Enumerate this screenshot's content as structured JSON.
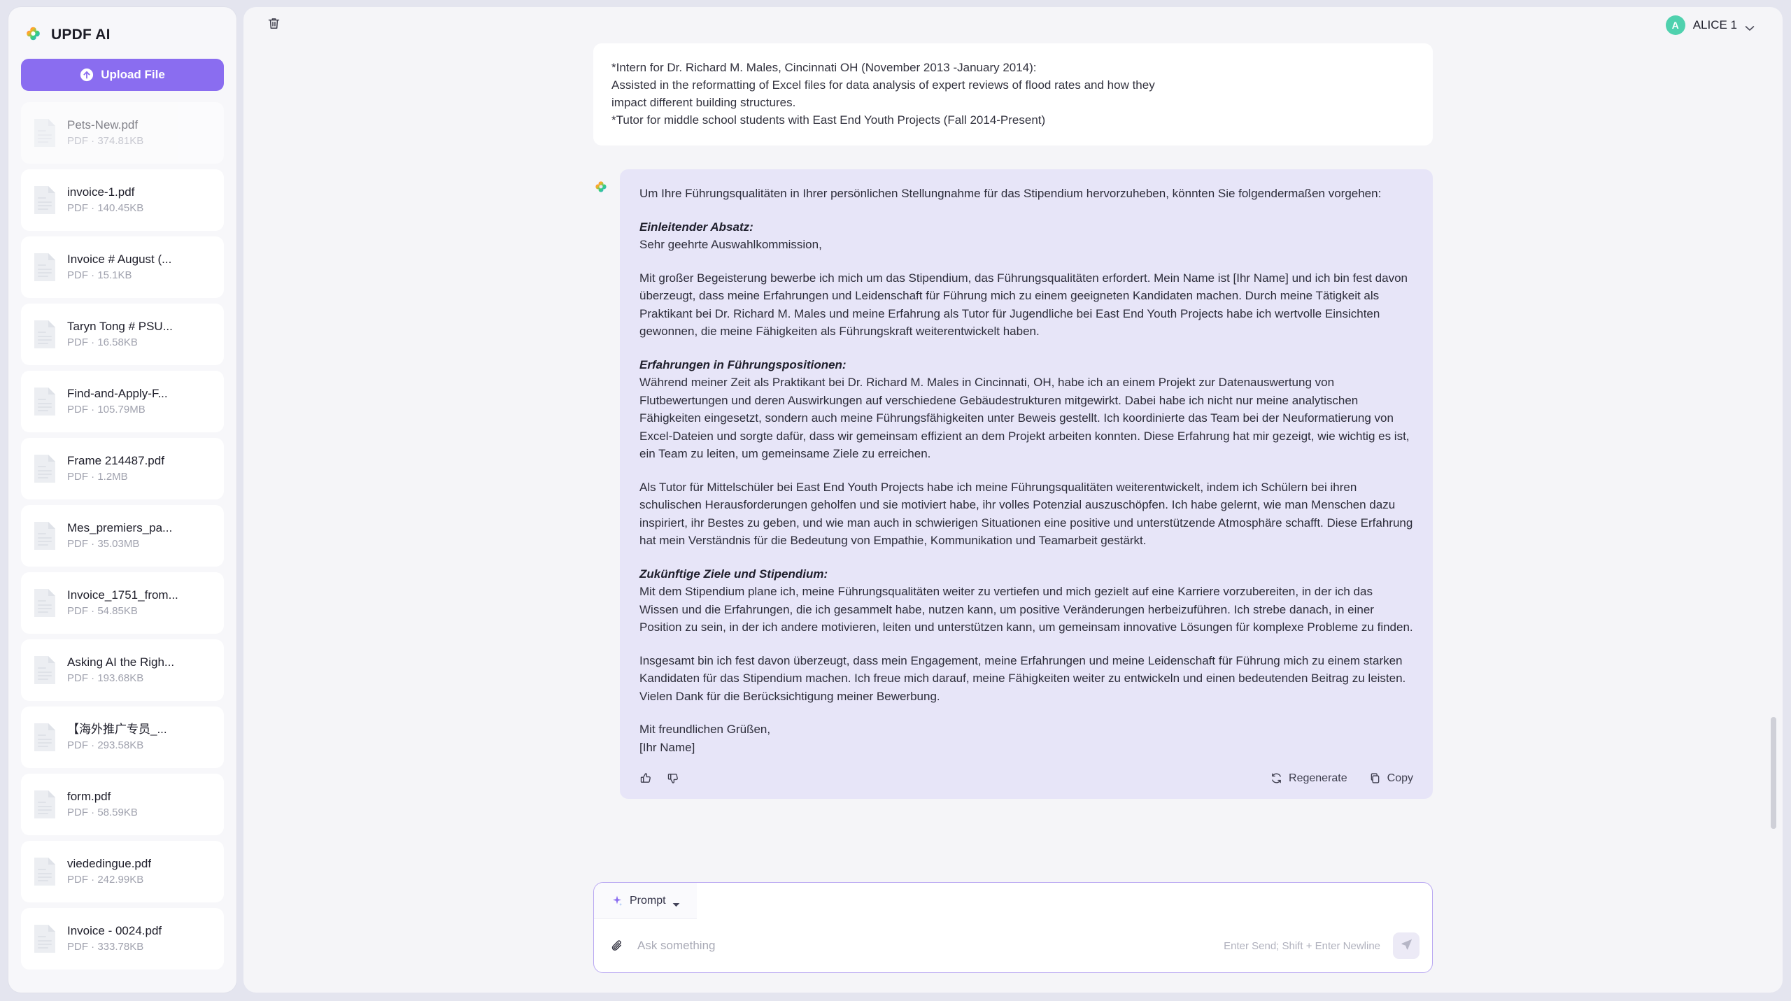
{
  "sidebar": {
    "brand": {
      "name": "UPDF AI",
      "logo_icon": "updf-flower-logo-icon"
    },
    "upload_button": {
      "label": "Upload File",
      "icon": "upload-arrow-icon"
    },
    "files": [
      {
        "name": "Pets-New.pdf",
        "meta": "PDF · 374.81KB"
      },
      {
        "name": "invoice-1.pdf",
        "meta": "PDF · 140.45KB"
      },
      {
        "name": "Invoice # August (...",
        "meta": "PDF · 15.1KB"
      },
      {
        "name": "Taryn Tong # PSU...",
        "meta": "PDF · 16.58KB"
      },
      {
        "name": "Find-and-Apply-F...",
        "meta": "PDF · 105.79MB"
      },
      {
        "name": "Frame 214487.pdf",
        "meta": "PDF · 1.2MB"
      },
      {
        "name": "Mes_premiers_pa...",
        "meta": "PDF · 35.03MB"
      },
      {
        "name": "Invoice_1751_from...",
        "meta": "PDF · 54.85KB"
      },
      {
        "name": "Asking AI the Righ...",
        "meta": "PDF · 193.68KB"
      },
      {
        "name": "【海外推广专员_...",
        "meta": "PDF · 293.58KB"
      },
      {
        "name": "form.pdf",
        "meta": "PDF · 58.59KB"
      },
      {
        "name": "viededingue.pdf",
        "meta": "PDF · 242.99KB"
      },
      {
        "name": "Invoice - 0024.pdf",
        "meta": "PDF · 333.78KB"
      }
    ]
  },
  "topbar": {
    "delete_icon": "trash-icon",
    "user": {
      "initial": "A",
      "name": "ALICE 1",
      "caret_icon": "chevron-down-icon"
    }
  },
  "conversation": {
    "user_message": "*Intern for Dr. Richard M. Males, Cincinnati OH (November 2013 -January 2014):\nAssisted in the reformatting of Excel files for data analysis of expert reviews of flood rates and how they\nimpact different building structures.\n*Tutor for middle school students with East End Youth Projects (Fall 2014-Present)",
    "ai_avatar_icon": "updf-ai-logo-icon",
    "ai_message": {
      "intro": "Um Ihre Führungsqualitäten in Ihrer persönlichen Stellungnahme für das Stipendium hervorzuheben, könnten Sie folgendermaßen vorgehen:",
      "sections": [
        {
          "heading": "Einleitender Absatz:",
          "paragraphs": [
            "Sehr geehrte Auswahlkommission,",
            "Mit großer Begeisterung bewerbe ich mich um das Stipendium, das Führungsqualitäten erfordert. Mein Name ist [Ihr Name] und ich bin fest davon überzeugt, dass meine Erfahrungen und Leidenschaft für Führung mich zu einem geeigneten Kandidaten machen. Durch meine Tätigkeit als Praktikant bei Dr. Richard M. Males und meine Erfahrung als Tutor für Jugendliche bei East End Youth Projects habe ich wertvolle Einsichten gewonnen, die meine Fähigkeiten als Führungskraft weiterentwickelt haben."
          ]
        },
        {
          "heading": "Erfahrungen in Führungspositionen:",
          "paragraphs": [
            "Während meiner Zeit als Praktikant bei Dr. Richard M. Males in Cincinnati, OH, habe ich an einem Projekt zur Datenauswertung von Flutbewertungen und deren Auswirkungen auf verschiedene Gebäudestrukturen mitgewirkt. Dabei habe ich nicht nur meine analytischen Fähigkeiten eingesetzt, sondern auch meine Führungsfähigkeiten unter Beweis gestellt. Ich koordinierte das Team bei der Neuformatierung von Excel-Dateien und sorgte dafür, dass wir gemeinsam effizient an dem Projekt arbeiten konnten. Diese Erfahrung hat mir gezeigt, wie wichtig es ist, ein Team zu leiten, um gemeinsame Ziele zu erreichen.",
            "Als Tutor für Mittelschüler bei East End Youth Projects habe ich meine Führungsqualitäten weiterentwickelt, indem ich Schülern bei ihren schulischen Herausforderungen geholfen und sie motiviert habe, ihr volles Potenzial auszuschöpfen. Ich habe gelernt, wie man Menschen dazu inspiriert, ihr Bestes zu geben, und wie man auch in schwierigen Situationen eine positive und unterstützende Atmosphäre schafft. Diese Erfahrung hat mein Verständnis für die Bedeutung von Empathie, Kommunikation und Teamarbeit gestärkt."
          ]
        },
        {
          "heading": "Zukünftige Ziele und Stipendium:",
          "paragraphs": [
            "Mit dem Stipendium plane ich, meine Führungsqualitäten weiter zu vertiefen und mich gezielt auf eine Karriere vorzubereiten, in der ich das Wissen und die Erfahrungen, die ich gesammelt habe, nutzen kann, um positive Veränderungen herbeizuführen. Ich strebe danach, in einer Position zu sein, in der ich andere motivieren, leiten und unterstützen kann, um gemeinsam innovative Lösungen für komplexe Probleme zu finden.",
            "Insgesamt bin ich fest davon überzeugt, dass mein Engagement, meine Erfahrungen und meine Leidenschaft für Führung mich zu einem starken Kandidaten für das Stipendium machen. Ich freue mich darauf, meine Fähigkeiten weiter zu entwickeln und einen bedeutenden Beitrag zu leisten. Vielen Dank für die Berücksichtigung meiner Bewerbung."
          ]
        }
      ],
      "signature": "Mit freundlichen Grüßen,\n[Ihr Name]"
    },
    "actions": {
      "thumbs_up_icon": "thumbs-up-icon",
      "thumbs_down_icon": "thumbs-down-icon",
      "regenerate_label": "Regenerate",
      "regenerate_icon": "refresh-icon",
      "copy_label": "Copy",
      "copy_icon": "copy-icon"
    }
  },
  "composer": {
    "prompt_label": "Prompt",
    "prompt_icon": "sparkle-icon",
    "dropdown_icon": "triangle-down-icon",
    "attach_icon": "paperclip-icon",
    "input_value": "",
    "input_placeholder": "Ask something",
    "hint": "Enter Send; Shift + Enter Newline",
    "send_icon": "send-paper-plane-icon"
  },
  "colors": {
    "accent": "#8a6df0",
    "ai_bubble": "#e7e5f8",
    "page_bg": "#e4e5ef",
    "avatar": "#4fd1ae"
  }
}
